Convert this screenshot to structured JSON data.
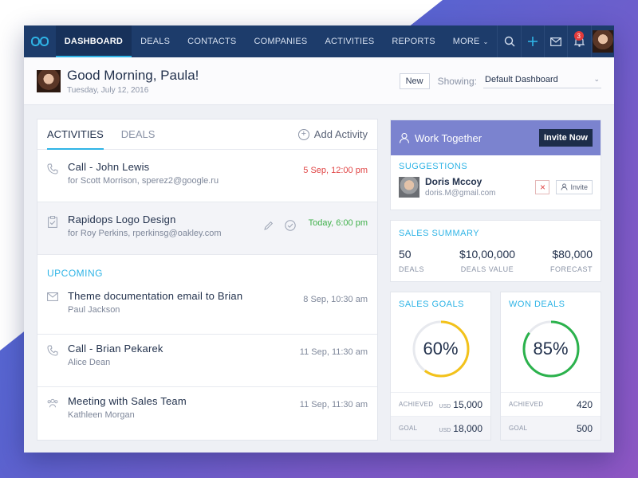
{
  "nav": {
    "items": [
      "DASHBOARD",
      "DEALS",
      "CONTACTS",
      "COMPANIES",
      "ACTIVITIES",
      "REPORTS",
      "MORE"
    ],
    "active_index": 0,
    "notification_count": "3",
    "icons": [
      "search-icon",
      "plus-icon",
      "mail-icon",
      "bell-icon"
    ]
  },
  "greeting": {
    "title": "Good Morning, Paula!",
    "date": "Tuesday, July 12, 2016",
    "new_label": "New",
    "showing_label": "Showing:",
    "dashboard_select": "Default Dashboard"
  },
  "activities_panel": {
    "tabs": [
      "ACTIVITIES",
      "DEALS"
    ],
    "add_label": "Add Activity",
    "items": [
      {
        "title": "Call - John Lewis",
        "sub": "for Scott Morrison, sperez2@google.ru",
        "time": "5 Sep, 12:00 pm",
        "icon": "phone-icon"
      },
      {
        "title": "Rapidops Logo Design",
        "sub": "for Roy Perkins, rperkinsg@oakley.com",
        "time": "Today, 6:00 pm",
        "icon": "clipboard-icon"
      }
    ],
    "upcoming_label": "UPCOMING",
    "upcoming": [
      {
        "title": "Theme documentation email to Brian",
        "sub": "Paul Jackson",
        "time": "8 Sep, 10:30 am",
        "icon": "mail-icon"
      },
      {
        "title": "Call - Brian Pekarek",
        "sub": "Alice Dean",
        "time": "11 Sep, 11:30 am",
        "icon": "phone-icon"
      },
      {
        "title": "Meeting with Sales Team",
        "sub": "Kathleen Morgan",
        "time": "11 Sep, 11:30 am",
        "icon": "group-icon"
      }
    ]
  },
  "work_together": {
    "title": "Work Together",
    "invite_now": "Invite Now",
    "suggestions_label": "SUGGESTIONS",
    "suggestion": {
      "name": "Doris Mccoy",
      "email": "doris.M@gmail.com",
      "invite": "Invite"
    }
  },
  "sales_summary": {
    "label": "SALES SUMMARY",
    "stats": [
      {
        "value": "50",
        "label": "DEALS"
      },
      {
        "value": "$10,00,000",
        "label": "DEALS VALUE"
      },
      {
        "value": "$80,000",
        "label": "FORECAST"
      }
    ]
  },
  "sales_goals": {
    "label": "SALES GOALS",
    "percent_text": "60%",
    "percent": 0.6,
    "color": "#f3c21a",
    "achieved_label": "ACHIEVED",
    "achieved_currency": "USD",
    "achieved_value": "15,000",
    "goal_label": "GOAL",
    "goal_currency": "USD",
    "goal_value": "18,000"
  },
  "won_deals": {
    "label": "WON DEALS",
    "percent_text": "85%",
    "percent": 0.85,
    "color": "#2bb24c",
    "achieved_label": "ACHIEVED",
    "achieved_value": "420",
    "goal_label": "GOAL",
    "goal_value": "500"
  }
}
